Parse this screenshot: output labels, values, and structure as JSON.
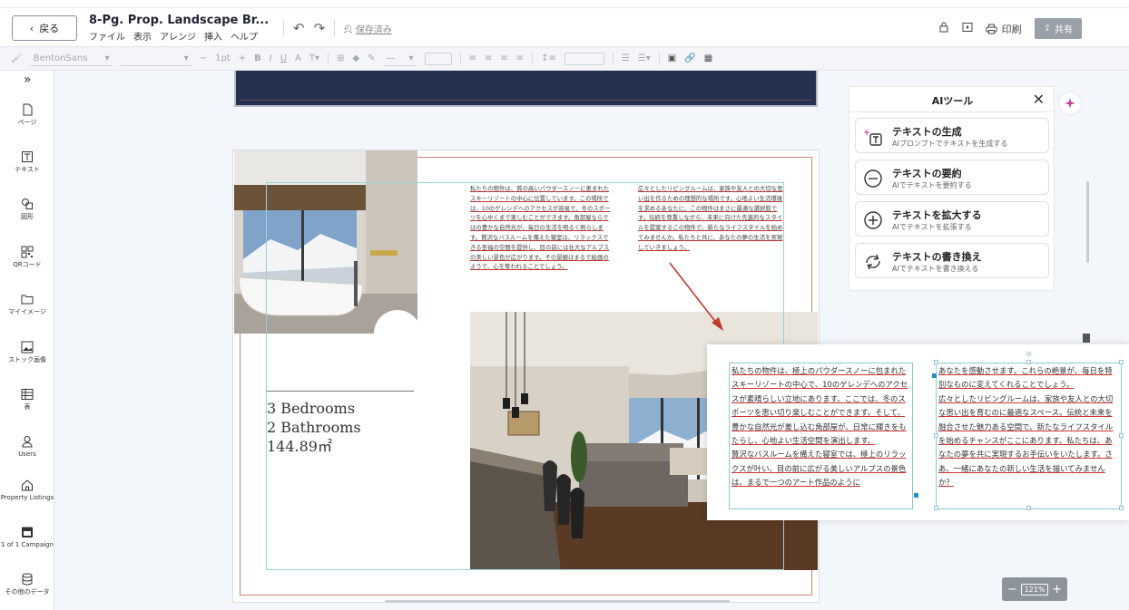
{
  "header": {
    "back_label": "戻る",
    "doc_title": "8-Pg. Prop. Landscape Br...",
    "menu": [
      "ファイル",
      "表示",
      "アレンジ",
      "挿入",
      "ヘルプ"
    ],
    "saved_label": "保存済み",
    "print_label": "印刷",
    "share_label": "共有"
  },
  "toolbar": {
    "font_name": "BentonSans",
    "font_size": "1pt"
  },
  "sidebar": {
    "items": [
      {
        "label": "ページ",
        "icon": "page-icon"
      },
      {
        "label": "テキスト",
        "icon": "text-icon"
      },
      {
        "label": "図形",
        "icon": "shapes-icon"
      },
      {
        "label": "QRコード",
        "icon": "qr-icon"
      },
      {
        "label": "マイイメージ",
        "icon": "folder-icon"
      },
      {
        "label": "ストック画像",
        "icon": "image-icon"
      },
      {
        "label": "表",
        "icon": "table-icon"
      },
      {
        "label": "Users",
        "icon": "user-icon"
      },
      {
        "label": "Property Listings",
        "icon": "home-icon"
      },
      {
        "label": "1 of 1 Campaign",
        "icon": "calendar-icon"
      },
      {
        "label": "その他のデータ",
        "icon": "database-icon"
      }
    ]
  },
  "page": {
    "stats": [
      "3 Bedrooms",
      "2 Bathrooms",
      "144.89㎡"
    ],
    "col1": "私たちの物件は、質の高いパウダースノーに恵まれたスキーリゾートの中心に位置しています。この場所では、10のゲレンデへのアクセスが容易で、冬のスポーツを心ゆくまで楽しむことができます。角部屋ならではの豊かな自然光が、毎日の生活を明るく照らします。贅沢なバスルームを備えた寝室は、リラックスできる至福の空間を提供し、目の前には壮大なアルプスの美しい景色が広がります。その景観はまるで絵画のようで、心を奪われることでしょう。",
    "col2": "広々としたリビングルームは、家族や友人との大切な思い出を作るための理想的な場所です。心地よい生活環境を求めるあなたに、この物件はまさに最適な選択肢です。伝統を尊重しながら、未来に向けた先進的なスタイルを提案するこの物件で、新たなライフスタイルを始めてみませんか。私たちと共に、あなたの夢の生活を実現していきましょう。"
  },
  "callout": {
    "col1": [
      "私たちの物件は、極上のパウダースノーに包まれたスキーリゾートの中心で、10のゲレンデへのアクセスが素晴らしい立地にあります。ここでは、冬のスポーツを思い切り楽しむことができます。そして、豊かな自然光が差し込む角部屋が、日常に輝きをもたらし、心地よい生活空間を演出します。",
      "贅沢なバスルームを備えた寝室では、極上のリラックスが叶い、目の前に広がる美しいアルプスの景色は、まるで一つのアート作品のように"
    ],
    "col2": [
      "あなたを感動させます。これらの絶景が、毎日を特別なものに変えてくれることでしょう。",
      "広々としたリビングルームは、家族や友人との大切な思い出を育むのに最適なスペース。伝統と未来を融合させた魅力ある空間で、新たなライフスタイルを始めるチャンスがここにあります。私たちは、あなたの夢を共に実現するお手伝いをいたします。さあ、一緒にあなたの新しい生活を描いてみませんか？"
    ]
  },
  "ai_panel": {
    "title": "AIツール",
    "tools": [
      {
        "title": "テキストの生成",
        "desc": "AIプロンプトでテキストを生成する",
        "icon": "generate-text-icon"
      },
      {
        "title": "テキストの要約",
        "desc": "AIでテキストを要約する",
        "icon": "summarize-icon"
      },
      {
        "title": "テキストを拡大する",
        "desc": "AIでテキストを拡張する",
        "icon": "expand-icon"
      },
      {
        "title": "テキストの書き換え",
        "desc": "AIでテキストを書き換える",
        "icon": "rewrite-icon"
      }
    ]
  },
  "zoom": {
    "value": "121%"
  },
  "colors": {
    "accent_red": "#c0392b",
    "navy": "#23304f",
    "guide": "#9fd0d8"
  }
}
